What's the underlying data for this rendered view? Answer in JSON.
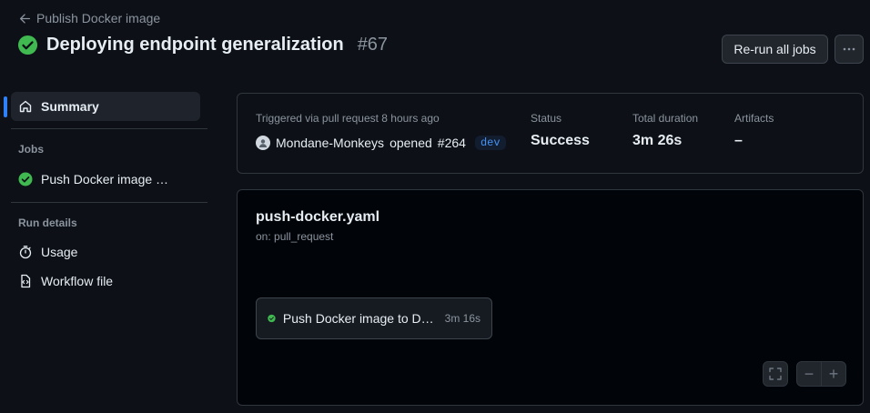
{
  "header": {
    "back_label": "Publish Docker image",
    "title": "Deploying endpoint generalization",
    "run_number": "#67",
    "rerun_label": "Re-run all jobs",
    "more_label": "···"
  },
  "sidebar": {
    "summary_label": "Summary",
    "jobs_heading": "Jobs",
    "job_label": "Push Docker image …",
    "run_details_heading": "Run details",
    "usage_label": "Usage",
    "workflow_file_label": "Workflow file"
  },
  "summary": {
    "triggered_text": "Triggered via pull request 8 hours ago",
    "actor": "Mondane-Monkeys",
    "action": "opened",
    "pr": "#264",
    "branch": "dev",
    "status_label": "Status",
    "status_value": "Success",
    "duration_label": "Total duration",
    "duration_value": "3m 26s",
    "artifacts_label": "Artifacts",
    "artifacts_value": "–"
  },
  "graph": {
    "workflow_file": "push-docker.yaml",
    "trigger": "on: pull_request",
    "job_name": "Push Docker image to D…",
    "job_duration": "3m 16s",
    "zoom_out": "−",
    "zoom_in": "+"
  },
  "colors": {
    "success": "#3fb950",
    "accent": "#2f81f7"
  }
}
